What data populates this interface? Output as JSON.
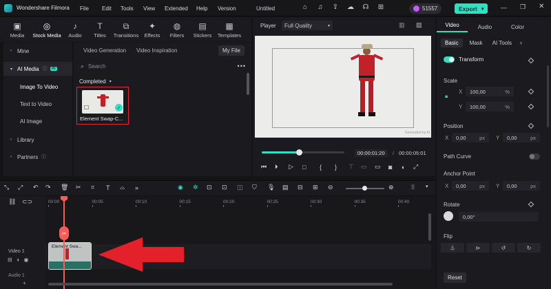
{
  "app": {
    "name": "Wondershare Filmora",
    "project": "Untitled"
  },
  "menu": [
    "File",
    "Edit",
    "Tools",
    "View",
    "Extended",
    "Help",
    "Version"
  ],
  "credits": "51557",
  "export_label": "Export",
  "toolbar": [
    "Media",
    "Stock Media",
    "Audio",
    "Titles",
    "Transitions",
    "Effects",
    "Filters",
    "Stickers",
    "Templates"
  ],
  "sidebar": {
    "mine": "Mine",
    "ai_media": "AI Media",
    "ai_badge": "AI",
    "sub": [
      "Image To Video",
      "Text to Video",
      "AI Image"
    ],
    "library": "Library",
    "partners": "Partners"
  },
  "media": {
    "tabs": [
      "Video Generation",
      "Video Inspiration"
    ],
    "my_file": "My File",
    "search_placeholder": "Search",
    "completed": "Completed",
    "thumb_label": "Element Swap-C..."
  },
  "player": {
    "label": "Player",
    "quality": "Full Quality",
    "current_time": "00:00:01:20",
    "total_time": "00:00:05:01",
    "progress": 0.45,
    "watermark": "Generated by AI"
  },
  "props": {
    "tabs": [
      "Video",
      "Audio",
      "Color"
    ],
    "subtabs": [
      "Basic",
      "Mask",
      "AI Tools"
    ],
    "transform": "Transform",
    "scale": "Scale",
    "scale_x": "100,00",
    "scale_y": "100,00",
    "percent": "%",
    "position": "Position",
    "pos_x": "0,00",
    "pos_y": "0,00",
    "px": "px",
    "path_curve": "Path Curve",
    "anchor_point": "Anchor Point",
    "anchor_x": "0,00",
    "anchor_y": "0,00",
    "rotate": "Rotate",
    "rotate_value": "0,00°",
    "flip": "Flip",
    "reset": "Reset",
    "x": "X",
    "y": "Y"
  },
  "timeline": {
    "ruler": [
      "00:00",
      "00:05",
      "00:10",
      "00:15",
      "00:20",
      "00:25",
      "00:30",
      "00:35",
      "00:40"
    ],
    "video_track": "Video 1",
    "audio_track": "Audio 1",
    "clip_label": "Element Swa..."
  },
  "colors": {
    "accent": "#2fe0c3",
    "playhead": "#ff5a5a",
    "arrow": "#e4202a"
  }
}
